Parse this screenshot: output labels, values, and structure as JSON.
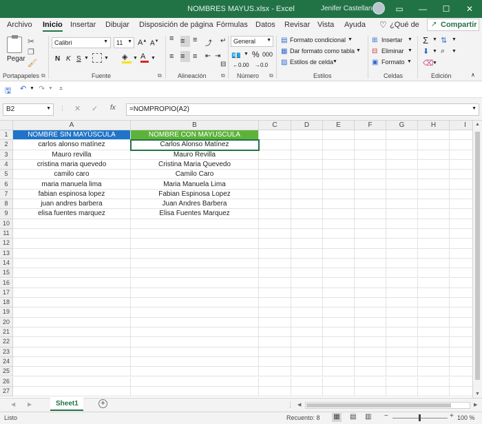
{
  "window": {
    "title": "NOMBRES MAYUS.xlsx  -  Excel",
    "user": "Jenifer Castellano",
    "minimize_glyph": "—",
    "maximize_glyph": "☐",
    "close_glyph": "✕"
  },
  "tabs": [
    "Archivo",
    "Inicio",
    "Insertar",
    "Dibujar",
    "Disposición de página",
    "Fórmulas",
    "Datos",
    "Revisar",
    "Vista",
    "Ayuda",
    "¿Qué de"
  ],
  "share_label": "Compartir",
  "ribbon": {
    "clipboard": {
      "paste_label": "Pegar",
      "group_label": "Portapapeles"
    },
    "font": {
      "name": "Calibri",
      "size": "11",
      "bold": "N",
      "italic": "K",
      "underline": "S",
      "group_label": "Fuente"
    },
    "alignment": {
      "group_label": "Alineación"
    },
    "number": {
      "format": "General",
      "percent": "%",
      "thousands": "000",
      "group_label": "Número"
    },
    "styles": {
      "conditional": "Formato condicional",
      "table": "Dar formato como tabla",
      "cell_styles": "Estilos de celda",
      "group_label": "Estilos"
    },
    "cells": {
      "insert": "Insertar",
      "delete": "Eliminar",
      "format": "Formato",
      "group_label": "Celdas"
    },
    "editing": {
      "group_label": "Edición"
    }
  },
  "formula_bar": {
    "cell_ref": "B2",
    "formula": "=NOMPROPIO(A2)",
    "fx_label": "fx"
  },
  "columns": [
    "A",
    "B",
    "C",
    "D",
    "E",
    "F",
    "G",
    "H",
    "I"
  ],
  "rows": [
    "1",
    "2",
    "3",
    "4",
    "5",
    "6",
    "7",
    "8",
    "9",
    "10",
    "11",
    "12",
    "13",
    "14",
    "15",
    "16",
    "17",
    "18",
    "19",
    "20",
    "21",
    "22",
    "23",
    "24",
    "25",
    "26",
    "27"
  ],
  "headers": {
    "a1": "NOMBRE SIN MAYÚSCULA",
    "b1": "NOMBRE CON MAYUSCULA"
  },
  "data": [
    [
      "carlos alonso matínez",
      "Carlos Alonso Matínez"
    ],
    [
      "Mauro revilla",
      "Mauro Revilla"
    ],
    [
      "cristina maria quevedo",
      "Cristina Maria Quevedo"
    ],
    [
      "camilo caro",
      "Camilo Caro"
    ],
    [
      "maria manuela lima",
      "Maria Manuela Lima"
    ],
    [
      "fabian espinosa lopez",
      "Fabian Espinosa Lopez"
    ],
    [
      "juan andres barbera",
      "Juan Andres Barbera"
    ],
    [
      "elisa fuentes marquez",
      "Elisa Fuentes Marquez"
    ]
  ],
  "colors": {
    "header_a": "#1e74c8",
    "header_b": "#5db33a",
    "accent": "#217346"
  },
  "sheet": {
    "tab_label": "Sheet1",
    "add_glyph": "+"
  },
  "status": {
    "ready": "Listo",
    "count": "Recuento: 8",
    "zoom": "100 %"
  }
}
